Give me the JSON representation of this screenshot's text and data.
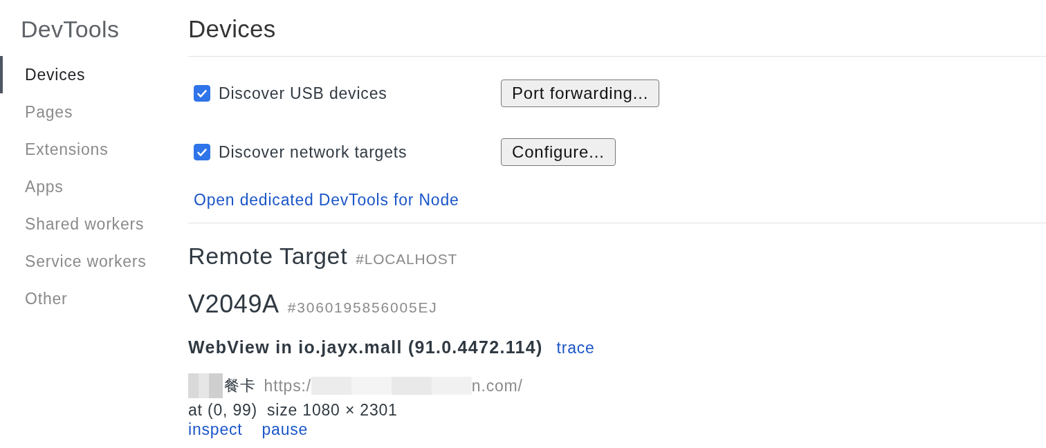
{
  "sidebar": {
    "title": "DevTools",
    "items": [
      {
        "label": "Devices",
        "selected": true
      },
      {
        "label": "Pages",
        "selected": false
      },
      {
        "label": "Extensions",
        "selected": false
      },
      {
        "label": "Apps",
        "selected": false
      },
      {
        "label": "Shared workers",
        "selected": false
      },
      {
        "label": "Service workers",
        "selected": false
      },
      {
        "label": "Other",
        "selected": false
      }
    ]
  },
  "main": {
    "title": "Devices",
    "options": [
      {
        "label": "Discover USB devices",
        "checked": true,
        "button": "Port forwarding..."
      },
      {
        "label": "Discover network targets",
        "checked": true,
        "button": "Configure..."
      }
    ],
    "node_link": "Open dedicated DevTools for Node"
  },
  "remote_target": {
    "title": "Remote Target",
    "id": "#LOCALHOST",
    "device": {
      "name": "V2049A",
      "serial": "#3060195856005EJ",
      "browser": {
        "name": "WebView in io.jayx.mall (91.0.4472.114)",
        "action": "trace"
      },
      "pages": [
        {
          "redacted": true,
          "title": "餐卡",
          "url_start": "https:/",
          "url_end": "n.com/",
          "position": "at (0, 99)",
          "size": "size 1080 × 2301",
          "actions": [
            "inspect",
            "pause"
          ]
        }
      ]
    }
  }
}
